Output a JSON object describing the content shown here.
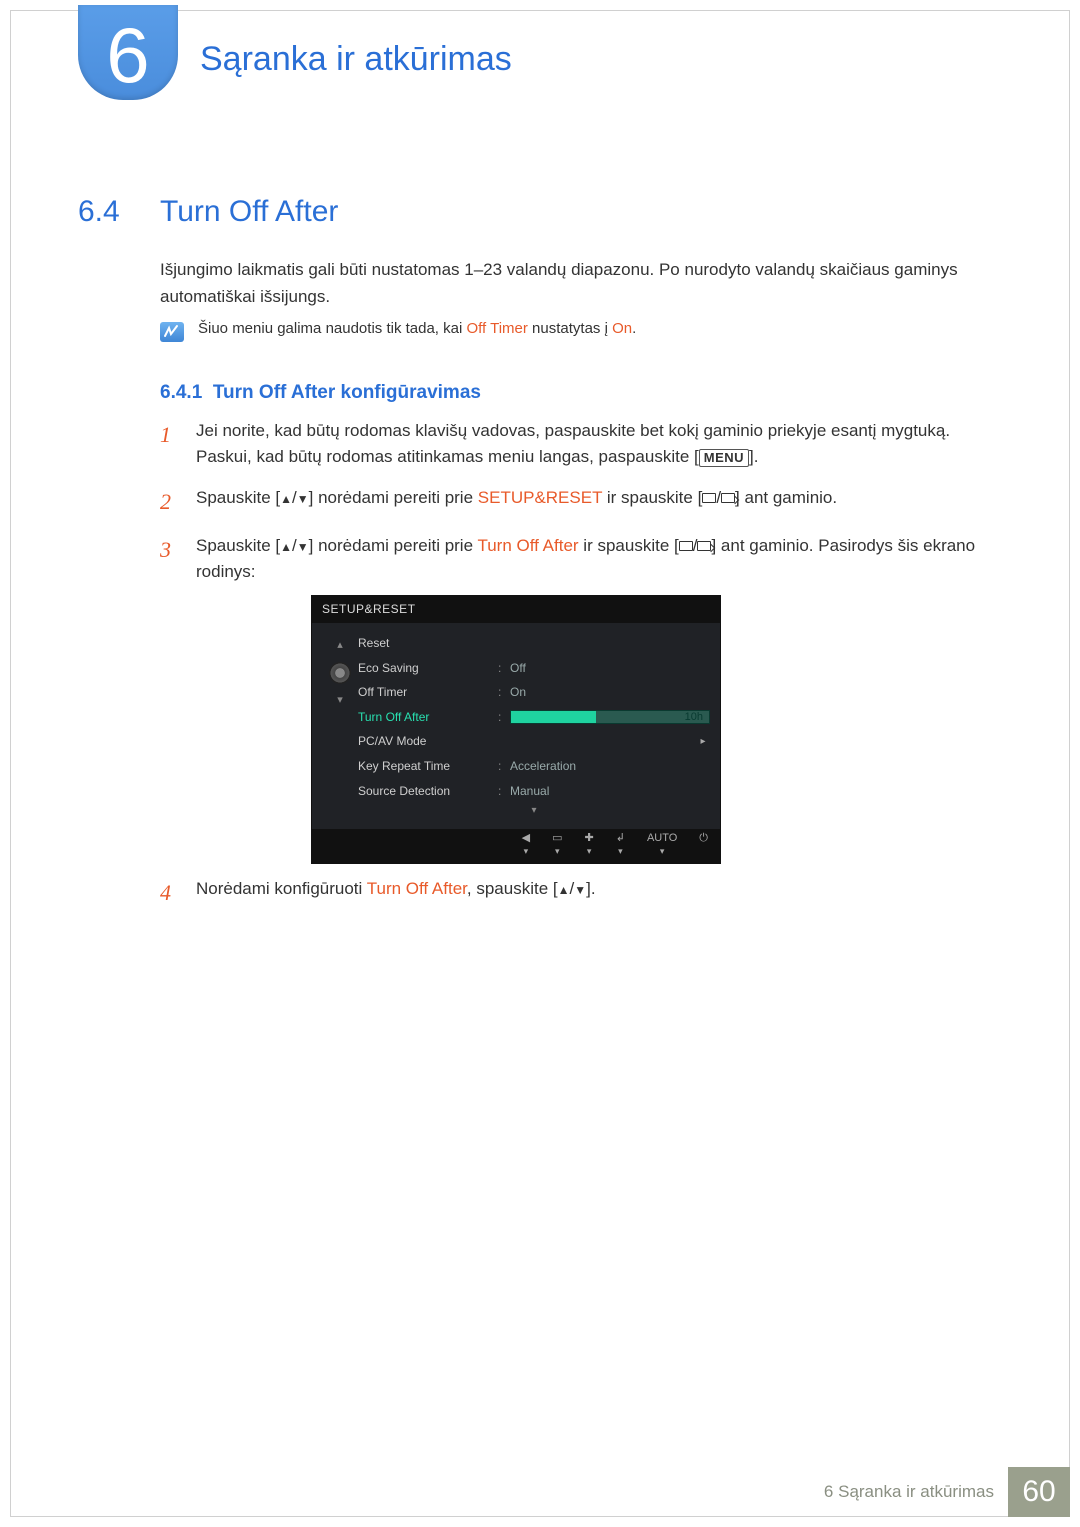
{
  "chapter": {
    "number": "6",
    "title": "Sąranka ir atkūrimas"
  },
  "section": {
    "number": "6.4",
    "title": "Turn Off After"
  },
  "intro": "Išjungimo laikmatis gali būti nustatomas 1–23 valandų diapazonu. Po nurodyto valandų skaičiaus gaminys automatiškai išsijungs.",
  "note": {
    "pre": "Šiuo meniu galima naudotis tik tada, kai ",
    "b1": "Off Timer",
    "mid": " nustatytas į ",
    "b2": "On",
    "post": "."
  },
  "subsection": {
    "number": "6.4.1",
    "title": "Turn Off After konfigūravimas"
  },
  "steps": {
    "s1": {
      "num": "1",
      "text_a": "Jei norite, kad būtų rodomas klavišų vadovas, paspauskite bet kokį gaminio priekyje esantį mygtuką. Paskui, kad būtų rodomas atitinkamas meniu langas, paspauskite [",
      "menu": "MENU",
      "text_b": "]."
    },
    "s2": {
      "num": "2",
      "text_a": "Spauskite [",
      "text_b": "] norėdami pereiti prie ",
      "hl": "SETUP&RESET",
      "text_c": " ir spauskite [",
      "text_d": "] ant gaminio."
    },
    "s3": {
      "num": "3",
      "text_a": "Spauskite [",
      "text_b": "] norėdami pereiti prie ",
      "hl": "Turn Off After",
      "text_c": " ir spauskite [",
      "text_d": "] ant gaminio. Pasirodys šis ekrano rodinys:"
    },
    "s4": {
      "num": "4",
      "text_a": "Norėdami konfigūruoti ",
      "hl": "Turn Off After",
      "text_b": ", spauskite [",
      "text_c": "]."
    }
  },
  "osd": {
    "title": "SETUP&RESET",
    "rows": {
      "reset": {
        "label": "Reset",
        "val": ""
      },
      "eco": {
        "label": "Eco Saving",
        "val": "Off"
      },
      "offtimer": {
        "label": "Off Timer",
        "val": "On"
      },
      "turnoff": {
        "label": "Turn Off After",
        "val": "10h"
      },
      "pcav": {
        "label": "PC/AV Mode",
        "val": ""
      },
      "keyrep": {
        "label": "Key Repeat Time",
        "val": "Acceleration"
      },
      "srcdet": {
        "label": "Source Detection",
        "val": "Manual"
      }
    },
    "footer": {
      "auto": "AUTO"
    }
  },
  "footer": {
    "text": "6 Sąranka ir atkūrimas",
    "page": "60"
  }
}
